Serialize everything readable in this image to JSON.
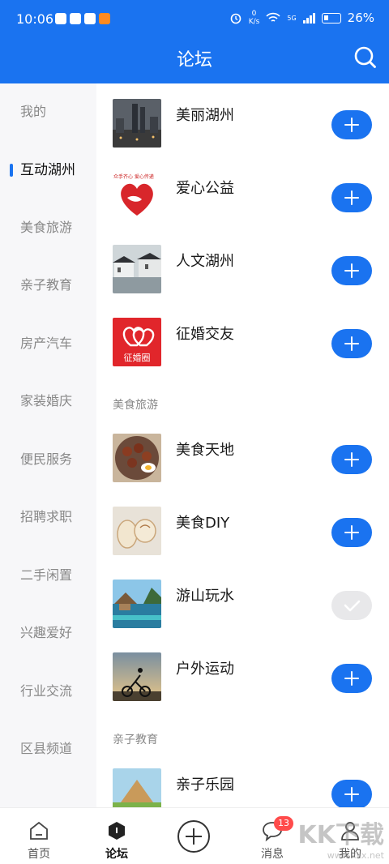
{
  "statusbar": {
    "time": "10:06",
    "net_speed_top": "0",
    "net_speed_bottom": "K/s",
    "battery": "26%",
    "network": "5G"
  },
  "header": {
    "title": "论坛"
  },
  "sidebar": {
    "items": [
      {
        "label": "我的"
      },
      {
        "label": "互动湖州",
        "active": true
      },
      {
        "label": "美食旅游"
      },
      {
        "label": "亲子教育"
      },
      {
        "label": "房产汽车"
      },
      {
        "label": "家装婚庆"
      },
      {
        "label": "便民服务"
      },
      {
        "label": "招聘求职"
      },
      {
        "label": "二手闲置"
      },
      {
        "label": "兴趣爱好"
      },
      {
        "label": "行业交流"
      },
      {
        "label": "区县频道"
      }
    ]
  },
  "content": {
    "rows": [
      {
        "name": "美丽湖州",
        "followed": false
      },
      {
        "name": "爱心公益",
        "followed": false
      },
      {
        "name": "人文湖州",
        "followed": false
      },
      {
        "name": "征婚交友",
        "followed": false
      }
    ],
    "sections": [
      {
        "label": "美食旅游",
        "rows": [
          {
            "name": "美食天地",
            "followed": false
          },
          {
            "name": "美食DIY",
            "followed": false
          },
          {
            "name": "游山玩水",
            "followed": true
          },
          {
            "name": "户外运动",
            "followed": false
          }
        ]
      },
      {
        "label": "亲子教育",
        "rows": [
          {
            "name": "亲子乐园",
            "followed": false
          }
        ]
      }
    ],
    "thumb_texts": {
      "aixin": "众手齐心 爱心传递",
      "zhenghun": "征婚圈"
    }
  },
  "tabbar": {
    "tabs": [
      {
        "label": "首页"
      },
      {
        "label": "论坛",
        "active": true
      },
      {
        "label": ""
      },
      {
        "label": "消息",
        "badge": "13"
      },
      {
        "label": "我的"
      }
    ]
  },
  "watermark": {
    "brand": "KK下载",
    "url": "www.kkx.net"
  },
  "colors": {
    "primary": "#1a73f0",
    "sidebar_bg": "#f7f7f9",
    "badge": "#ff4b4b"
  }
}
